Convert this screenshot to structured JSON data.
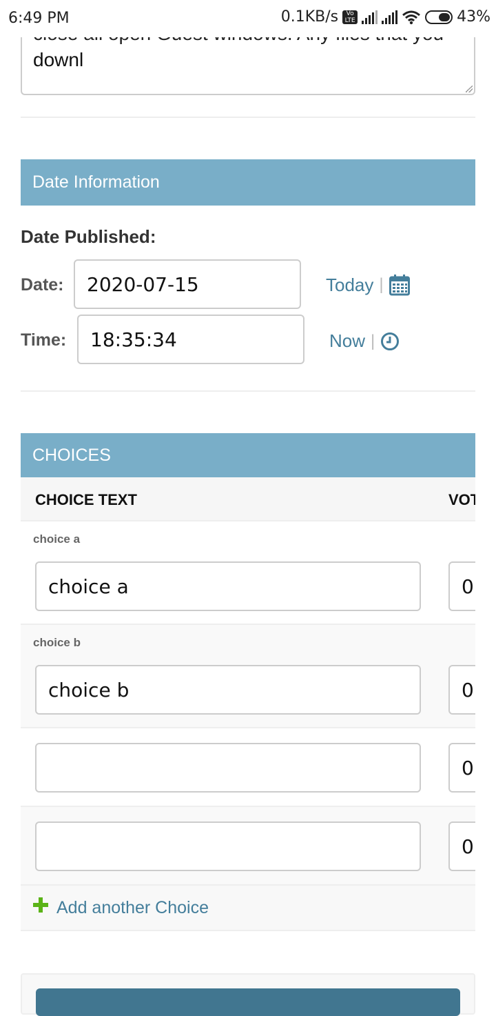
{
  "status_bar": {
    "time": "6:49 PM",
    "net_speed": "0.1KB/s",
    "lte_badge": "Vo LTE",
    "battery": "43%",
    "icons": [
      "volte-icon",
      "signal-icon",
      "signal-icon",
      "wifi-icon",
      "battery-icon"
    ]
  },
  "description_field": {
    "visible_text_top": "close all open Guest windows. Any files that you",
    "visible_text": "downl"
  },
  "date_section": {
    "header": "Date Information",
    "label": "Date Published:",
    "date_label": "Date:",
    "date_value": "2020-07-15",
    "today_link": "Today",
    "separator": "|",
    "time_label": "Time:",
    "time_value": "18:35:34",
    "now_link": "Now",
    "icons": [
      "calendar-icon",
      "clock-icon"
    ]
  },
  "choices_section": {
    "header": "CHOICES",
    "columns": [
      "CHOICE TEXT",
      "VOT"
    ],
    "rows": [
      {
        "original": "choice a",
        "text": "choice a",
        "votes": "0"
      },
      {
        "original": "choice b",
        "text": "choice b",
        "votes": "0"
      },
      {
        "original": "",
        "text": "",
        "votes": "0"
      },
      {
        "original": "",
        "text": "",
        "votes": "0"
      }
    ],
    "add_link": "Add another Choice"
  },
  "colors": {
    "header_bg": "#79aec8",
    "link": "#447e9b",
    "add_icon": "#5bb318"
  }
}
